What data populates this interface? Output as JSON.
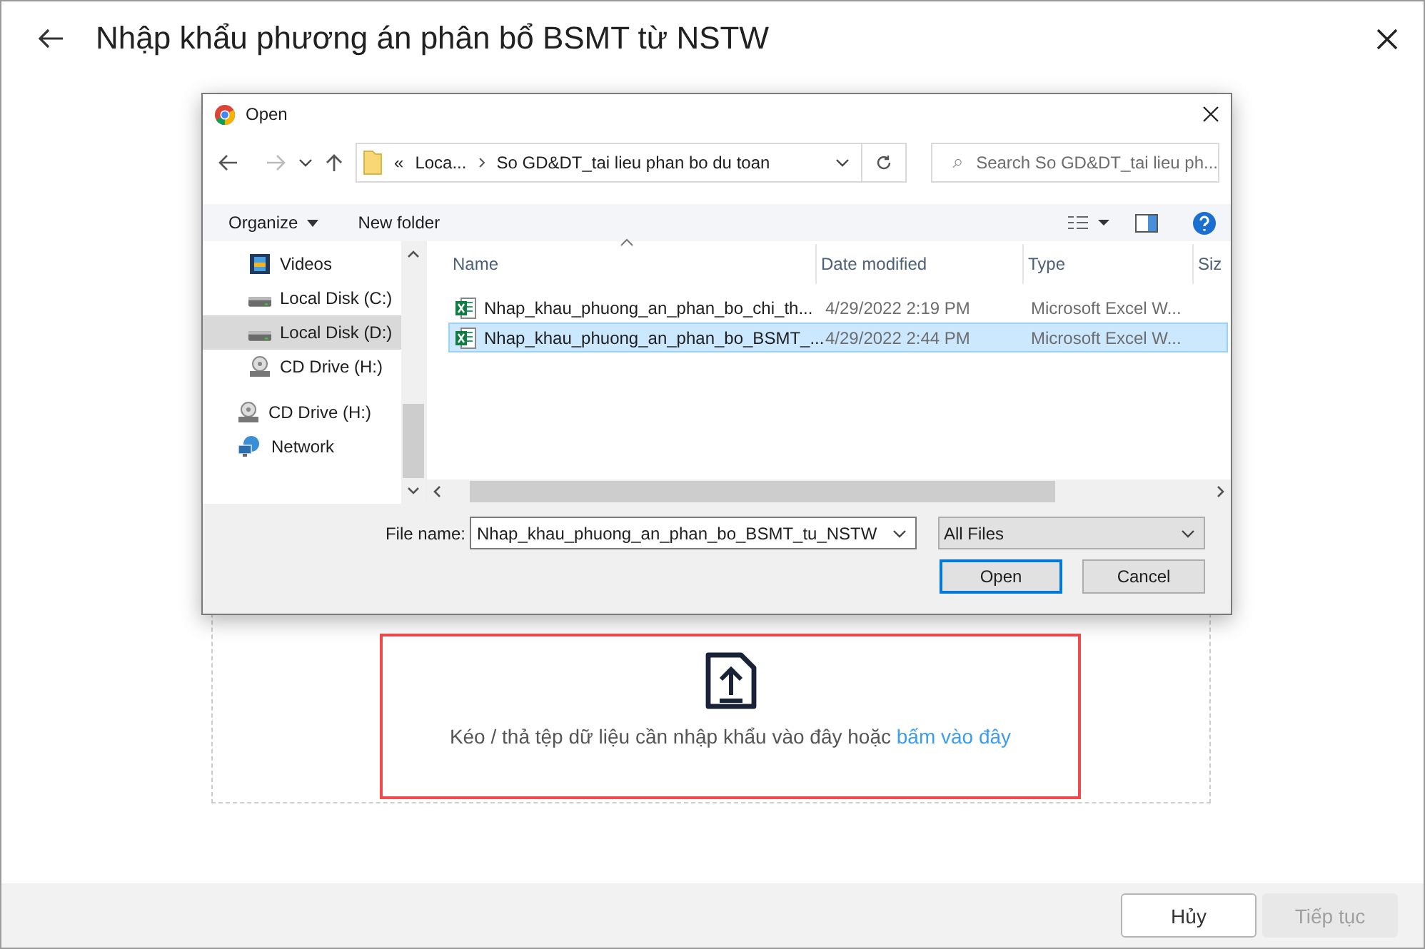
{
  "page": {
    "title": "Nhập khẩu phương án phân bổ BSMT từ NSTW"
  },
  "drop_zone": {
    "text": "Kéo / thả tệp dữ liệu cần nhập khẩu vào đây hoặc",
    "link": "bấm vào đây"
  },
  "footer": {
    "buttons": [
      {
        "label": "Hủy",
        "disabled": false
      },
      {
        "label": "Tiếp tục",
        "disabled": true
      }
    ]
  },
  "dialog": {
    "title": "Open",
    "address": {
      "prefix": "«",
      "crumbs": [
        "Loca...",
        "So GD&DT_tai lieu phan bo du toan"
      ]
    },
    "search": {
      "placeholder": "Search So GD&DT_tai lieu ph..."
    },
    "toolbar": {
      "organize": "Organize",
      "new_folder": "New folder"
    },
    "nav_pane": {
      "nested_items": [
        {
          "label": "Videos",
          "kind": "videos",
          "selected": false
        },
        {
          "label": "Local Disk (C:)",
          "kind": "disk",
          "selected": false
        },
        {
          "label": "Local Disk (D:)",
          "kind": "disk",
          "selected": true
        },
        {
          "label": "CD Drive (H:)",
          "kind": "cd",
          "selected": false
        }
      ],
      "items": [
        {
          "label": "CD Drive (H:)",
          "kind": "cd",
          "selected": false
        },
        {
          "label": "Network",
          "kind": "network",
          "selected": false
        }
      ]
    },
    "columns": [
      "Name",
      "Date modified",
      "Type",
      "Siz"
    ],
    "files": [
      {
        "name": "Nhap_khau_phuong_an_phan_bo_chi_th...",
        "date": "4/29/2022 2:19 PM",
        "type": "Microsoft Excel W...",
        "selected": false
      },
      {
        "name": "Nhap_khau_phuong_an_phan_bo_BSMT_...",
        "date": "4/29/2022 2:44 PM",
        "type": "Microsoft Excel W...",
        "selected": true
      }
    ],
    "file_name": {
      "label": "File name:",
      "value": "Nhap_khau_phuong_an_phan_bo_BSMT_tu_NSTW"
    },
    "file_type": "All Files",
    "buttons": [
      {
        "label": "Open",
        "default": true
      },
      {
        "label": "Cancel",
        "default": false
      }
    ]
  }
}
